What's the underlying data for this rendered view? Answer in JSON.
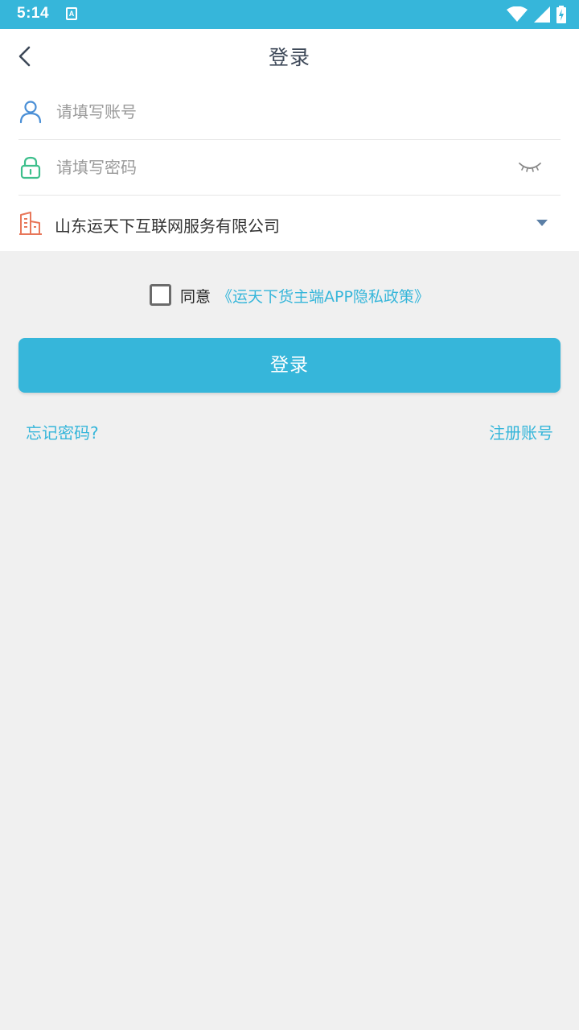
{
  "status_bar": {
    "time": "5:14",
    "notification_icon": "a-letter-icon",
    "icons": [
      "wifi-icon",
      "cell-signal-icon",
      "battery-charging-icon"
    ]
  },
  "header": {
    "title": "登录",
    "back_icon": "chevron-left-icon"
  },
  "form": {
    "account": {
      "placeholder": "请填写账号",
      "value": "",
      "icon": "user-icon"
    },
    "password": {
      "placeholder": "请填写密码",
      "value": "",
      "icon": "lock-icon",
      "toggle_icon": "eye-closed-icon"
    },
    "company": {
      "value": "山东运天下互联网服务有限公司",
      "icon": "building-icon",
      "dropdown_icon": "triangle-down-icon"
    }
  },
  "agreement": {
    "checked": false,
    "prefix": "同意",
    "link": "《运天下货主端APP隐私政策》"
  },
  "login_button": "登录",
  "forgot_password": "忘记密码?",
  "register": "注册账号",
  "colors": {
    "primary": "#36b6da",
    "background": "#f0f0f0",
    "user_icon": "#4a8fd6",
    "lock_icon": "#3dbf8c",
    "building_icon": "#e8775a"
  }
}
